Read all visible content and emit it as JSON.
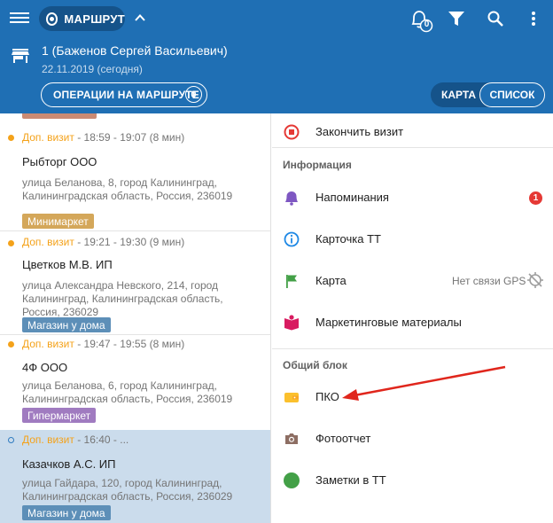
{
  "header": {
    "route_label": "МАРШРУТ",
    "notifications_count": "0",
    "agent_title": "1 (Баженов Сергей Васильевич)",
    "date": "22.11.2019 (сегодня)",
    "ops_button_label": "ОПЕРАЦИИ НА МАРШРУТЕ",
    "ops_count": "0",
    "view_map_label": "КАРТА",
    "view_list_label": "СПИСОК"
  },
  "visits": [
    {
      "kind": "Доп. визит",
      "time": " - 18:59 - 19:07 (8 мин)",
      "name": "Рыбторг ООО",
      "address": "улица Беланова, 8, город Калининград, Калининградская область, Россия, 236019",
      "tag": "Минимаркет",
      "tag_color": "#d4a75a",
      "status": "done"
    },
    {
      "kind": "Доп. визит",
      "time": " - 19:21 - 19:30 (9 мин)",
      "name": "Цветков М.В. ИП",
      "address": "улица Александра Невского, 214, город Калининград, Калининградская область, Россия, 236029",
      "tag": "Магазин у дома",
      "tag_color": "#5d8fb8",
      "status": "done"
    },
    {
      "kind": "Доп. визит",
      "time": " - 19:47 - 19:55 (8 мин)",
      "name": "4Ф ООО",
      "address": "улица Беланова, 6, город Калининград, Калининградская область, Россия, 236019",
      "tag": "Гипермаркет",
      "tag_color": "#a07bc0",
      "status": "done"
    },
    {
      "kind": "Доп. визит",
      "time": " - 16:40 - ...",
      "name": "Казачков А.С. ИП",
      "address": "улица Гайдара, 120, город Калининград, Калининградская область, Россия, 236029",
      "tag": "Магазин у дома",
      "tag_color": "#5d8fb8",
      "status": "active"
    }
  ],
  "menu": {
    "finish_visit": "Закончить визит",
    "section_info": "Информация",
    "reminders": "Напоминания",
    "reminders_count": "1",
    "card": "Карточка ТТ",
    "map": "Карта",
    "gps_status": "Нет связи GPS",
    "marketing": "Маркетинговые материалы",
    "section_common": "Общий блок",
    "pko": "ПКО",
    "photo_report": "Фотоотчет",
    "notes": "Заметки в ТТ"
  },
  "colors": {
    "appbar": "#1f6fb4",
    "appbar_dark": "#15538a",
    "accent_orange": "#f4a21a",
    "badge_red": "#e53935",
    "active_row": "#cbdcec",
    "arrow": "#e0261c"
  },
  "icons": [
    "menu-icon",
    "route-icon",
    "chevron-up-icon",
    "bell-icon",
    "filter-icon",
    "search-icon",
    "more-vert-icon",
    "store-icon",
    "stop-circle-icon",
    "bell-icon",
    "info-icon",
    "flag-icon",
    "book-icon",
    "gps-off-icon",
    "wallet-icon",
    "camera-icon",
    "note-icon"
  ]
}
